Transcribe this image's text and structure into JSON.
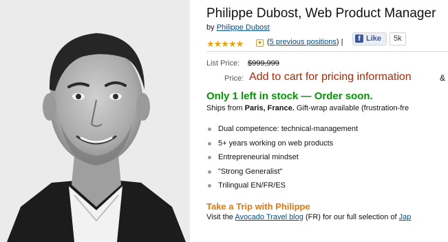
{
  "product": {
    "title": "Philippe Dubost, Web Product Manager",
    "by_prefix": "by",
    "author": "Philippe Dubost"
  },
  "rating": {
    "stars_glyph": "★★★★★",
    "dropdown_icon": "chevron-down-icon",
    "open_paren": "(",
    "previous_positions": "5 previous positions",
    "close_paren": ")",
    "separator": "|"
  },
  "facebook": {
    "icon": "facebook-icon",
    "like_label": "Like",
    "count": "5k"
  },
  "pricing": {
    "list_price_label": "List Price:",
    "list_price_value": "$999,999",
    "price_label": "Price:",
    "price_value": "Add to cart for pricing information",
    "price_suffix": "&"
  },
  "availability": {
    "stock_text": "Only 1 left in stock — Order soon.",
    "ships_prefix": "Ships from",
    "ships_location": "Paris, France.",
    "ships_suffix": "Gift-wrap available (frustration-fre"
  },
  "features": [
    "Dual competence: technical-management",
    "5+ years working on web products",
    "Entrepreneurial mindset",
    "\"Strong Generalist\"",
    "Trilingual EN/FR/ES"
  ],
  "trip": {
    "heading": "Take a Trip with Philippe",
    "visit_prefix": "Visit the",
    "blog_link": "Avocado Travel blog",
    "visit_middle": "(FR) for our full selection of",
    "visit_link_tail": "Jap"
  },
  "colors": {
    "price_red": "#b12704",
    "stock_green": "#009900",
    "trip_orange": "#e47911",
    "link_blue": "#004b91"
  }
}
